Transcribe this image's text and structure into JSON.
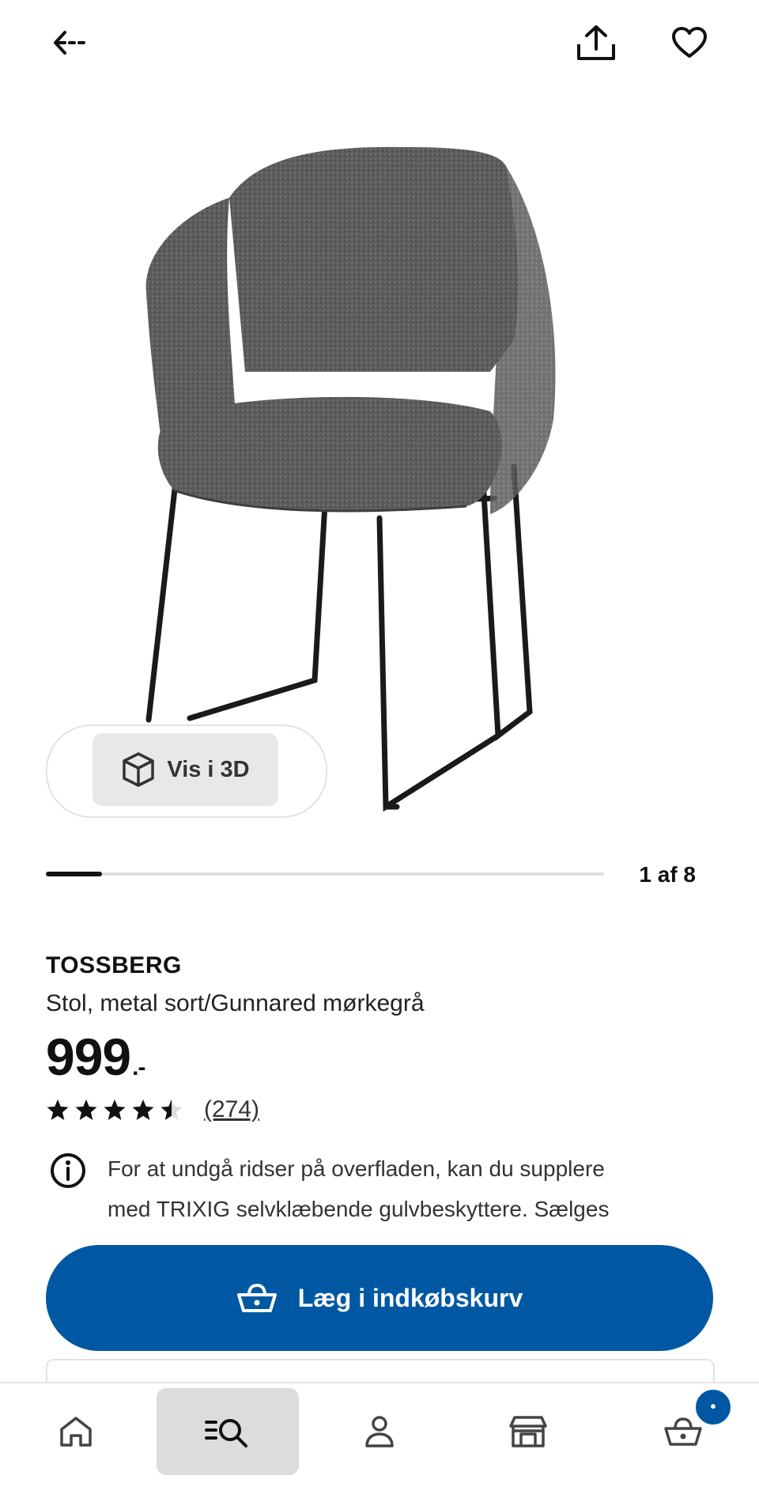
{
  "header": {
    "back_icon": "back-arrow-icon",
    "share_icon": "share-icon",
    "favorite_icon": "heart-icon"
  },
  "gallery": {
    "view_3d_label": "Vis i 3D",
    "counter": "1 af 8",
    "progress": 0.1,
    "image_icon": "chair-image"
  },
  "product": {
    "name": "TOSSBERG",
    "description": "Stol, metal sort/Gunnared mørkegrå",
    "price": "999",
    "price_suffix": ".-",
    "rating": 4.5,
    "review_count": "(274)",
    "info_line1": "For at undgå ridser på overfladen, kan du supplere",
    "info_line2": "med TRIXIG selvklæbende gulvbeskyttere. Sælges"
  },
  "cta": {
    "add_to_cart_label": "Læg i indkøbskurv",
    "color": "#0058a3"
  },
  "bottom_nav": {
    "items": [
      {
        "icon": "home-icon"
      },
      {
        "icon": "search-icon",
        "active": true
      },
      {
        "icon": "profile-icon"
      },
      {
        "icon": "store-icon"
      },
      {
        "icon": "cart-icon"
      }
    ],
    "cart_badge": "•"
  }
}
